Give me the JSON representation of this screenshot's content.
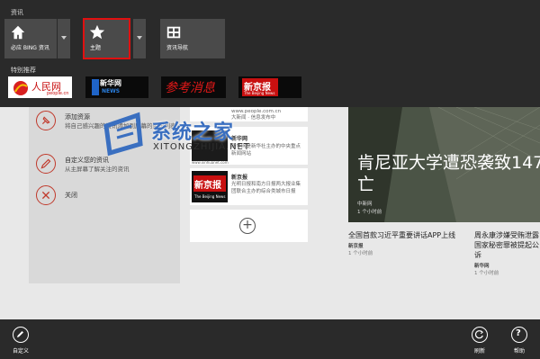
{
  "nav": {
    "section_label": "资讯",
    "tiles": [
      {
        "label": "必应 BING 资讯",
        "icon": "home-icon"
      },
      {
        "label": "主题",
        "icon": "star-icon"
      },
      {
        "label": "资讯导航",
        "icon": "grid-icon"
      }
    ],
    "featured_label": "特别推荐",
    "logos": [
      {
        "name": "people-cn-logo",
        "text": "人民网",
        "sub": "people.cn"
      },
      {
        "name": "xinhua-logo",
        "text": "新华网",
        "sub": "NEWS"
      },
      {
        "name": "cankao-xiaoxi-logo",
        "text": "参考消息"
      },
      {
        "name": "beijing-news-logo",
        "text": "新京报",
        "sub": "The Beijing News"
      }
    ]
  },
  "panel": {
    "options": [
      {
        "title": "添加资源",
        "desc": "将自己感兴趣的资讯添加到屏幕的资讯列表",
        "icon": "pin-icon"
      },
      {
        "title": "自定义您的资讯",
        "desc": "从主屏幕了解关注的资讯",
        "icon": "pencil-icon"
      },
      {
        "title": "关闭",
        "desc": "",
        "icon": "close-icon"
      }
    ]
  },
  "cards": {
    "people_snippet": "www.people.com.cn",
    "people_text": "大新闻 · 信息发布中",
    "xinhua_title": "新华网",
    "xinhua_desc": "新华网是新华社主办的中央重点新闻网站",
    "xinhua_url": "www.xinhuanet.com",
    "beijing_title": "新京报",
    "beijing_desc": "光明日报和南方日报两大报业集团联合主办的综合类城市日报",
    "beijing_logo_text": "新京报",
    "beijing_logo_sub": "The Beijing News",
    "add_symbol": "+"
  },
  "hero": {
    "title": "肯尼亚大学遭恐袭致147人死亡",
    "source": "中新网",
    "time": "1 个小时前"
  },
  "news": [
    {
      "title": "全国首款习近平重要讲话APP上线",
      "source": "新京报",
      "time": "1 个小时前"
    },
    {
      "title": "周永康涉嫌受贿泄露国家秘密罪被提起公诉",
      "source": "新华网",
      "time": "1 个小时前"
    }
  ],
  "watermark": {
    "main": "系统之家",
    "sub": "XITONGZHIJIA.NET"
  },
  "appbar": {
    "customize": "自定义",
    "refresh": "刷新",
    "help": "帮助"
  },
  "colors": {
    "accent": "#e01010",
    "bar": "#2a2a2a",
    "tile": "#4a4a4a"
  }
}
